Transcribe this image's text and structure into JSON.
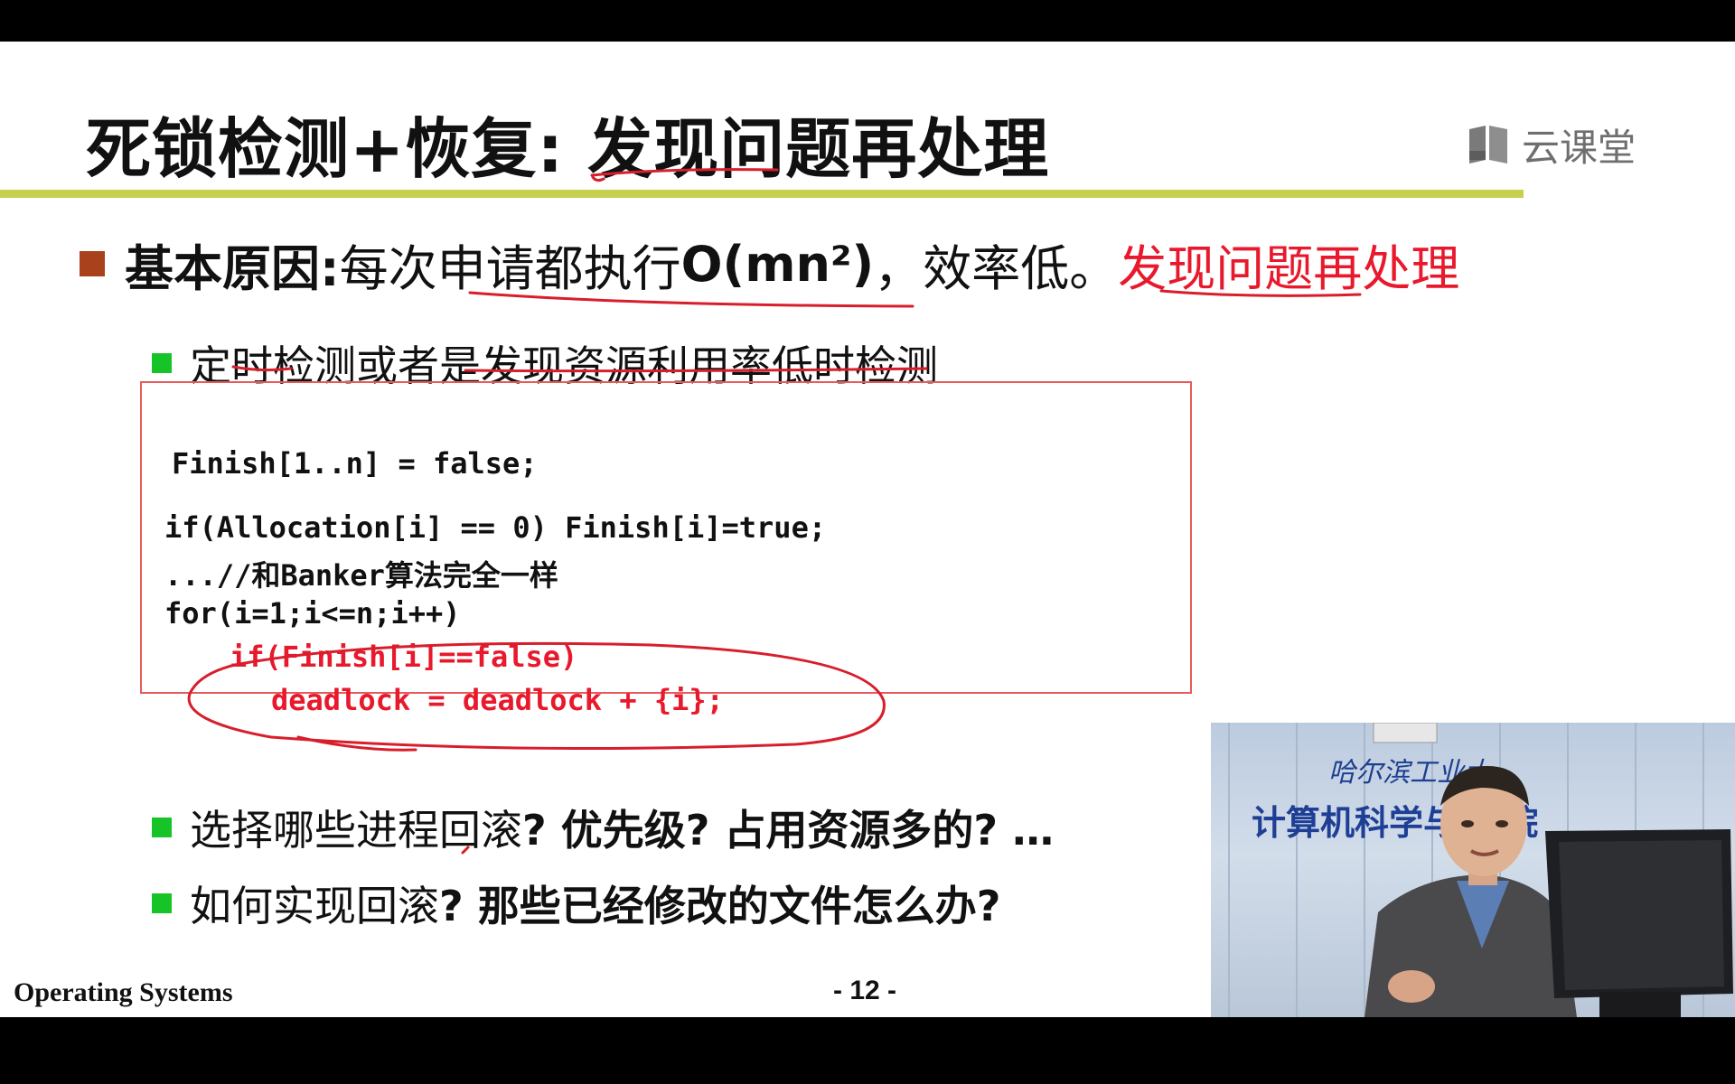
{
  "slide": {
    "title": "死锁检测+恢复: 发现问题再处理",
    "logo_text": "云课堂",
    "main_bullet": {
      "label": "基本原因:",
      "text1": " 每次申请都执行",
      "complexity": "O(mn²)",
      "text2": "，效率低。",
      "red_text": "发现问题再处理"
    },
    "sub1": "定时检测或者是发现资源利用率低时检测",
    "code": {
      "line1": "Finish[1..n] = false;",
      "line2": "if(Allocation[i] == 0) Finish[i]=true;",
      "line3": "...//和Banker算法完全一样",
      "line4": "for(i=1;i<=n;i++)",
      "line5": "if(Finish[i]==false)",
      "line6": "deadlock = deadlock + {i};"
    },
    "sub2": {
      "normal": "选择哪些进程回滚",
      "rest": "? 优先级? 占用资源多的? …"
    },
    "sub3": {
      "part1": "如何实现回滚",
      "part2": "? 那些已经修改的文件怎么办?"
    },
    "footer_left": "Operating Systems",
    "page": "- 12 -"
  },
  "video": {
    "school_text": "哈尔滨工业大",
    "dept_text": "计算机科学与技    院"
  },
  "colors": {
    "title_line": "#c6cf4f",
    "red": "#e8192c",
    "bullet_main": "#a9411d",
    "bullet_sub": "#17c428",
    "box_border": "#e85a5a"
  },
  "icons": [
    "logo-book-icon",
    "square-bullet-icon"
  ]
}
